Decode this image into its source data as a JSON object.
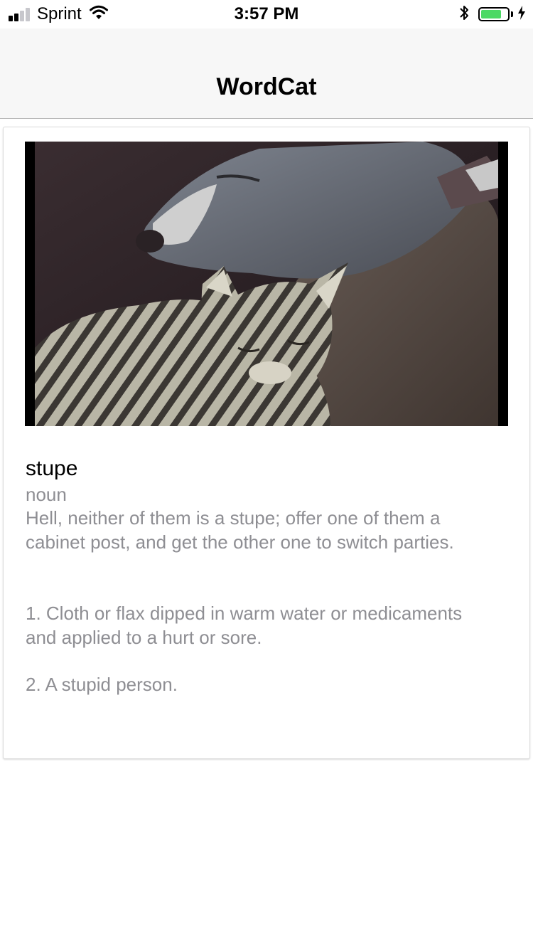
{
  "status_bar": {
    "carrier": "Sprint",
    "time": "3:57 PM",
    "signal_bars_filled": 2,
    "signal_bars_total": 4,
    "wifi_icon": "wifi-icon",
    "bluetooth_icon": "bluetooth-icon",
    "battery_level": 0.8,
    "charging_icon": "bolt-icon",
    "colors": {
      "battery_fill": "#4cd964",
      "signal_on": "#000000",
      "signal_off": "#c7c7cc"
    }
  },
  "nav": {
    "title": "WordCat"
  },
  "card": {
    "image_icon": "photo-dog-and-cat",
    "word": "stupe",
    "part_of_speech": "noun",
    "example": "Hell, neither of them is a stupe; offer one of them a cabinet post, and get the other one to switch parties.",
    "definitions": [
      "1. Cloth or flax dipped in warm water or medicaments and applied to a hurt or sore.",
      "2. A stupid person."
    ],
    "colors": {
      "secondary_text": "#8e8e93",
      "nav_background": "#f7f7f7"
    }
  }
}
